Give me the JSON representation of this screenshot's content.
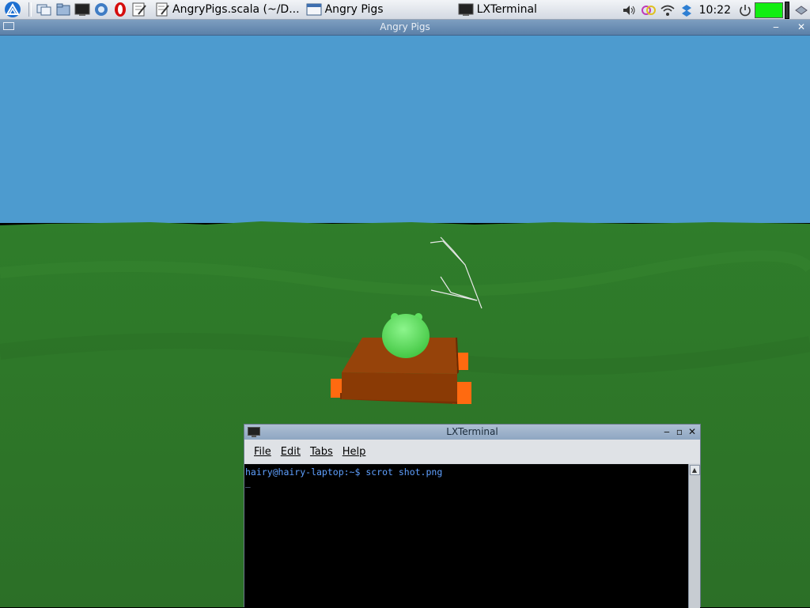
{
  "taskbar": {
    "tasks": [
      {
        "label": "AngryPigs.scala (~/D...",
        "icon": "text-editor-icon"
      },
      {
        "label": "Angry Pigs",
        "icon": "window-icon"
      },
      {
        "label": "LXTerminal",
        "icon": "terminal-icon"
      }
    ],
    "clock": "10:22",
    "battery_level": 1.0
  },
  "game_window": {
    "title": "Angry Pigs"
  },
  "terminal": {
    "title": "LXTerminal",
    "menu": [
      "File",
      "Edit",
      "Tabs",
      "Help"
    ],
    "prompt_line": "hairy@hairy-laptop:~$ scrot shot.png",
    "cursor": "_"
  },
  "colors": {
    "sky": "#4d9bcf",
    "grass": "#2f7a2a",
    "pig": "#52e052",
    "crate": "#8a3a05",
    "wheels": "#ff6a10",
    "battery": "#11ee11"
  }
}
